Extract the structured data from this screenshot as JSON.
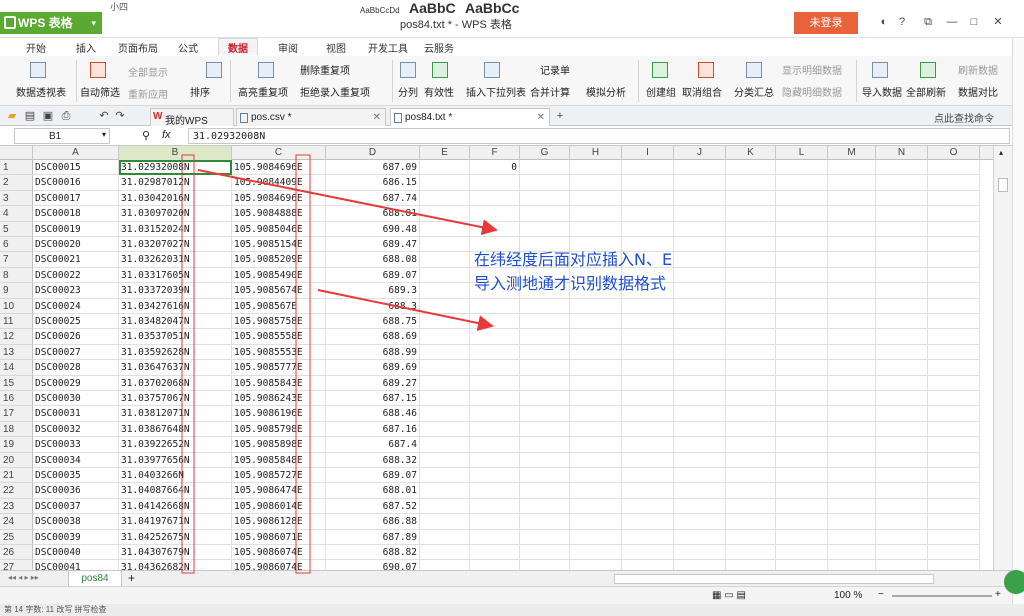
{
  "app": {
    "name": "WPS 表格",
    "window_title": "pos84.txt * - WPS 表格",
    "login_label": "未登录"
  },
  "top_strip": {
    "font_size": "小四",
    "font_samples": [
      "AaBbCcDd",
      "AaBbC",
      "AaBbCc",
      "AaBbC"
    ]
  },
  "ribbon_tabs": [
    "开始",
    "插入",
    "页面布局",
    "公式",
    "数据",
    "审阅",
    "视图",
    "开发工具",
    "云服务"
  ],
  "active_tab": "数据",
  "ribbon_buttons": [
    {
      "label": "数据透视表"
    },
    {
      "label": "自动筛选"
    },
    {
      "label": "全部显示"
    },
    {
      "label": "重新应用"
    },
    {
      "label": "排序"
    },
    {
      "label": "高亮重复项"
    },
    {
      "label": "删除重复项"
    },
    {
      "label": "拒绝录入重复项"
    },
    {
      "label": "分列"
    },
    {
      "label": "有效性"
    },
    {
      "label": "插入下拉列表"
    },
    {
      "label": "合并计算"
    },
    {
      "label": "模拟分析"
    },
    {
      "label": "记录单"
    },
    {
      "label": "创建组"
    },
    {
      "label": "取消组合"
    },
    {
      "label": "分类汇总"
    },
    {
      "label": "显示明细数据"
    },
    {
      "label": "隐藏明细数据"
    },
    {
      "label": "导入数据"
    },
    {
      "label": "全部刷新"
    },
    {
      "label": "刷新数据"
    },
    {
      "label": "数据对比"
    }
  ],
  "doc_tabs": [
    {
      "label": "我的WPS",
      "active": false
    },
    {
      "label": "pos.csv *",
      "active": false
    },
    {
      "label": "pos84.txt *",
      "active": true
    }
  ],
  "search_placeholder": "点此查找命令",
  "formula_bar": {
    "cell_ref": "B1",
    "fx": "fx",
    "value": "31.02932008N"
  },
  "columns": [
    "A",
    "B",
    "C",
    "D",
    "E",
    "F",
    "G",
    "H",
    "I",
    "J",
    "K",
    "L",
    "M",
    "N",
    "O"
  ],
  "rows": [
    {
      "n": "1",
      "a": "DSC00015",
      "b": "31.02932008N",
      "c": "105.9084696E",
      "d": "687.09",
      "f": "0"
    },
    {
      "n": "2",
      "a": "DSC00016",
      "b": "31.02987012N",
      "c": "105.9084409E",
      "d": "686.15",
      "f": ""
    },
    {
      "n": "3",
      "a": "DSC00017",
      "b": "31.03042016N",
      "c": "105.9084696E",
      "d": "687.74",
      "f": ""
    },
    {
      "n": "4",
      "a": "DSC00018",
      "b": "31.03097020N",
      "c": "105.9084888E",
      "d": "688.81",
      "f": ""
    },
    {
      "n": "5",
      "a": "DSC00019",
      "b": "31.03152024N",
      "c": "105.9085046E",
      "d": "690.48",
      "f": ""
    },
    {
      "n": "6",
      "a": "DSC00020",
      "b": "31.03207027N",
      "c": "105.9085154E",
      "d": "689.47",
      "f": ""
    },
    {
      "n": "7",
      "a": "DSC00021",
      "b": "31.03262031N",
      "c": "105.9085209E",
      "d": "688.08",
      "f": ""
    },
    {
      "n": "8",
      "a": "DSC00022",
      "b": "31.03317605N",
      "c": "105.9085490E",
      "d": "689.07",
      "f": ""
    },
    {
      "n": "9",
      "a": "DSC00023",
      "b": "31.03372039N",
      "c": "105.9085674E",
      "d": "689.3",
      "f": ""
    },
    {
      "n": "10",
      "a": "DSC00024",
      "b": "31.03427616N",
      "c": "105.908567E",
      "d": "688.3",
      "f": ""
    },
    {
      "n": "11",
      "a": "DSC00025",
      "b": "31.03482047N",
      "c": "105.9085758E",
      "d": "688.75",
      "f": ""
    },
    {
      "n": "12",
      "a": "DSC00026",
      "b": "31.03537051N",
      "c": "105.9085558E",
      "d": "688.69",
      "f": ""
    },
    {
      "n": "13",
      "a": "DSC00027",
      "b": "31.03592628N",
      "c": "105.9085553E",
      "d": "688.99",
      "f": ""
    },
    {
      "n": "14",
      "a": "DSC00028",
      "b": "31.03647637N",
      "c": "105.9085777E",
      "d": "689.69",
      "f": ""
    },
    {
      "n": "15",
      "a": "DSC00029",
      "b": "31.03702068N",
      "c": "105.9085843E",
      "d": "689.27",
      "f": ""
    },
    {
      "n": "16",
      "a": "DSC00030",
      "b": "31.03757067N",
      "c": "105.9086243E",
      "d": "687.15",
      "f": ""
    },
    {
      "n": "17",
      "a": "DSC00031",
      "b": "31.03812071N",
      "c": "105.9086196E",
      "d": "688.46",
      "f": ""
    },
    {
      "n": "18",
      "a": "DSC00032",
      "b": "31.03867648N",
      "c": "105.9085798E",
      "d": "687.16",
      "f": ""
    },
    {
      "n": "19",
      "a": "DSC00033",
      "b": "31.03922652N",
      "c": "105.9085898E",
      "d": "687.4",
      "f": ""
    },
    {
      "n": "20",
      "a": "DSC00034",
      "b": "31.03977656N",
      "c": "105.9085848E",
      "d": "688.32",
      "f": ""
    },
    {
      "n": "21",
      "a": "DSC00035",
      "b": "31.0403266N",
      "c": "105.9085727E",
      "d": "689.07",
      "f": ""
    },
    {
      "n": "22",
      "a": "DSC00036",
      "b": "31.04087664N",
      "c": "105.9086474E",
      "d": "688.01",
      "f": ""
    },
    {
      "n": "23",
      "a": "DSC00037",
      "b": "31.04142668N",
      "c": "105.9086014E",
      "d": "687.52",
      "f": ""
    },
    {
      "n": "24",
      "a": "DSC00038",
      "b": "31.04197671N",
      "c": "105.9086128E",
      "d": "686.88",
      "f": ""
    },
    {
      "n": "25",
      "a": "DSC00039",
      "b": "31.04252675N",
      "c": "105.9086071E",
      "d": "687.89",
      "f": ""
    },
    {
      "n": "26",
      "a": "DSC00040",
      "b": "31.04307679N",
      "c": "105.9086074E",
      "d": "688.82",
      "f": ""
    },
    {
      "n": "27",
      "a": "DSC00041",
      "b": "31.04362682N",
      "c": "105.9086074E",
      "d": "690.07",
      "f": ""
    }
  ],
  "annotation": {
    "line1": "在纬经度后面对应插入N、E",
    "line2": "导入测地通才识别数据格式"
  },
  "sheet_tab": "pos84",
  "status": {
    "zoom": "100 %",
    "bottom_text": "第 14 字数: 11 改写 拼写检查"
  },
  "colors": {
    "wps_green": "#5aa933",
    "login_orange": "#e8623a",
    "annotation_blue": "#1f4fd0",
    "annotation_red": "#e83a3a",
    "selection_green": "#2f8a3a"
  }
}
